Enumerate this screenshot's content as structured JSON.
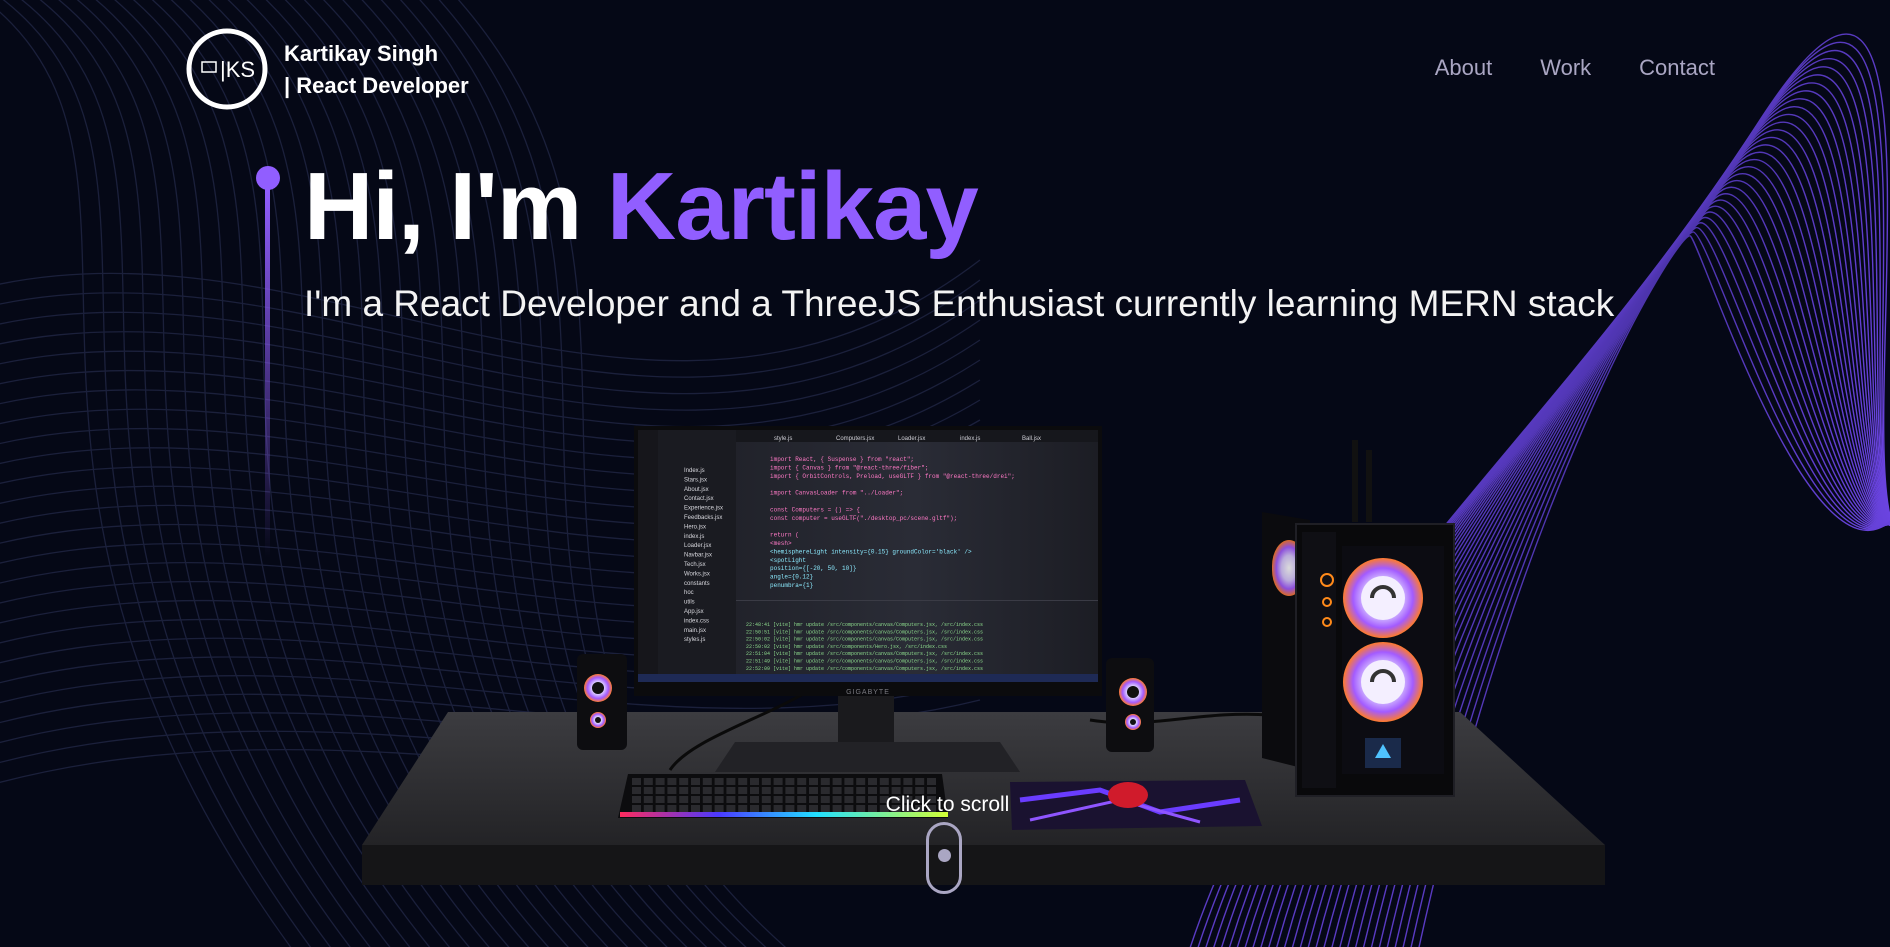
{
  "brand": {
    "logo_text": "|KS",
    "name": "Kartikay Singh",
    "role": "| React Developer"
  },
  "nav": {
    "items": [
      {
        "label": "About"
      },
      {
        "label": "Work"
      },
      {
        "label": "Contact"
      }
    ]
  },
  "hero": {
    "greeting": "Hi, I'm ",
    "name": "Kartikay",
    "subtitle": "I'm a React Developer and a ThreeJS Enthusiast currently learning MERN stack"
  },
  "scene": {
    "monitor_brand": "GIGABYTE",
    "editor_tabs": [
      "style.js",
      "Computers.jsx",
      "Loader.jsx",
      "index.js",
      "Ball.jsx"
    ],
    "code_lines": [
      "import React, { Suspense } from \"react\";",
      "import { Canvas } from \"@react-three/fiber\";",
      "import { OrbitControls, Preload, useGLTF } from \"@react-three/drei\";",
      "",
      "import CanvasLoader from \"../Loader\";",
      "",
      "const Computers = () => {",
      "  const computer = useGLTF(\"./desktop_pc/scene.gltf\");",
      "",
      "  return (",
      "    <mesh>",
      "      <hemisphereLight intensity={0.15} groundColor='black' />",
      "      <spotLight",
      "        position={[-20, 50, 10]}",
      "        angle={0.12}",
      "        penumbra={1}"
    ],
    "explorer_items": [
      "Index.js",
      "Stars.jsx",
      "About.jsx",
      "Contact.jsx",
      "Experience.jsx",
      "Feedbacks.jsx",
      "Hero.jsx",
      "index.js",
      "Loader.jsx",
      "Navbar.jsx",
      "Tech.jsx",
      "Works.jsx",
      "constants",
      "hoc",
      "utils",
      "App.jsx",
      "index.css",
      "main.jsx",
      "styles.js"
    ],
    "terminal_lines": [
      "22:48:41 [vite] hmr update /src/components/canvas/Computers.jsx, /src/index.css",
      "22:50:51 [vite] hmr update /src/components/canvas/Computers.jsx, /src/index.css",
      "22:50:02 [vite] hmr update /src/components/canvas/Computers.jsx, /src/index.css",
      "22:50:02 [vite] hmr update /src/components/Hero.jsx, /src/index.css",
      "22:51:04 [vite] hmr update /src/components/canvas/Computers.jsx, /src/index.css",
      "22:51:49 [vite] hmr update /src/components/canvas/Computers.jsx, /src/index.css",
      "22:52:09 [vite] hmr update /src/components/canvas/Computers.jsx, /src/index.css"
    ]
  },
  "scroll": {
    "label": "Click to scroll"
  },
  "colors": {
    "background": "#050816",
    "accent": "#915eff",
    "nav_text": "#aaa6c3",
    "text": "#ffffff"
  }
}
